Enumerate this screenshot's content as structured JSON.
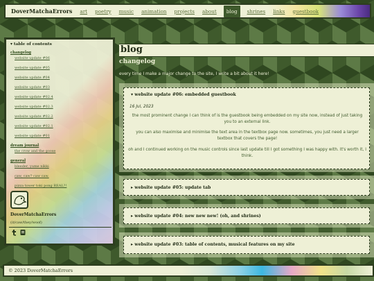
{
  "nav": {
    "brand": "DoverMatchaErrors",
    "links": [
      "art",
      "poetry",
      "music",
      "animation",
      "projects",
      "about",
      "blog",
      "shrines",
      "links",
      "guestbook"
    ],
    "active": "blog"
  },
  "sidebar": {
    "toc_title": "▾ table of contents",
    "groups": {
      "changelog": {
        "label": "changelog",
        "items": [
          "website update #06",
          "website update #05",
          "website update #04",
          "website update #03",
          "website update #02.4",
          "website update #02.3",
          "website update #02.2",
          "website update #02.1",
          "website update #01"
        ]
      },
      "dream_journal": {
        "label": "dream journal",
        "items": [
          "the crow and the goose"
        ]
      },
      "general": {
        "label": "general",
        "items": [
          "bleeder, yume nikki",
          "caw, caw? caw caw.",
          "pizza tower toki pong REAL?!"
        ]
      }
    },
    "profile": {
      "name": "DoverMatchaErrors",
      "pronouns": "(it/caw/they/woof)"
    }
  },
  "main": {
    "title": "blog",
    "section": "changelog",
    "intro": "every time I make a major change to the site, I write a bit about it here!",
    "entries": [
      {
        "summary": "▾ website update #06: embedded guestbook",
        "date": "16 Jul, 2023",
        "paragraphs": [
          "the most prominent change I can think of is the guestbook being embedded on my site now, instead of just taking you to an external link.",
          "you can also maximise and minimise the text area in the textbox page now. sometimes, you just need a larger textbox that covers the page!",
          "oh and I continued working on the music controls since last update till I got something I was happy with. It's worth it, I think."
        ]
      },
      {
        "summary": "▸ website update #05: update tab"
      },
      {
        "summary": "▸ website update #04: new new new! (oh, and shrines)"
      },
      {
        "summary": "▸ website update #03: table of contents, musical features on my site"
      }
    ]
  },
  "footer": {
    "text": "© 2023 DoverMatchaErrors"
  },
  "colors": {
    "accent_dark": "#2d3d1f",
    "panel": "#eef0d6",
    "link": "#3f5a2c"
  }
}
